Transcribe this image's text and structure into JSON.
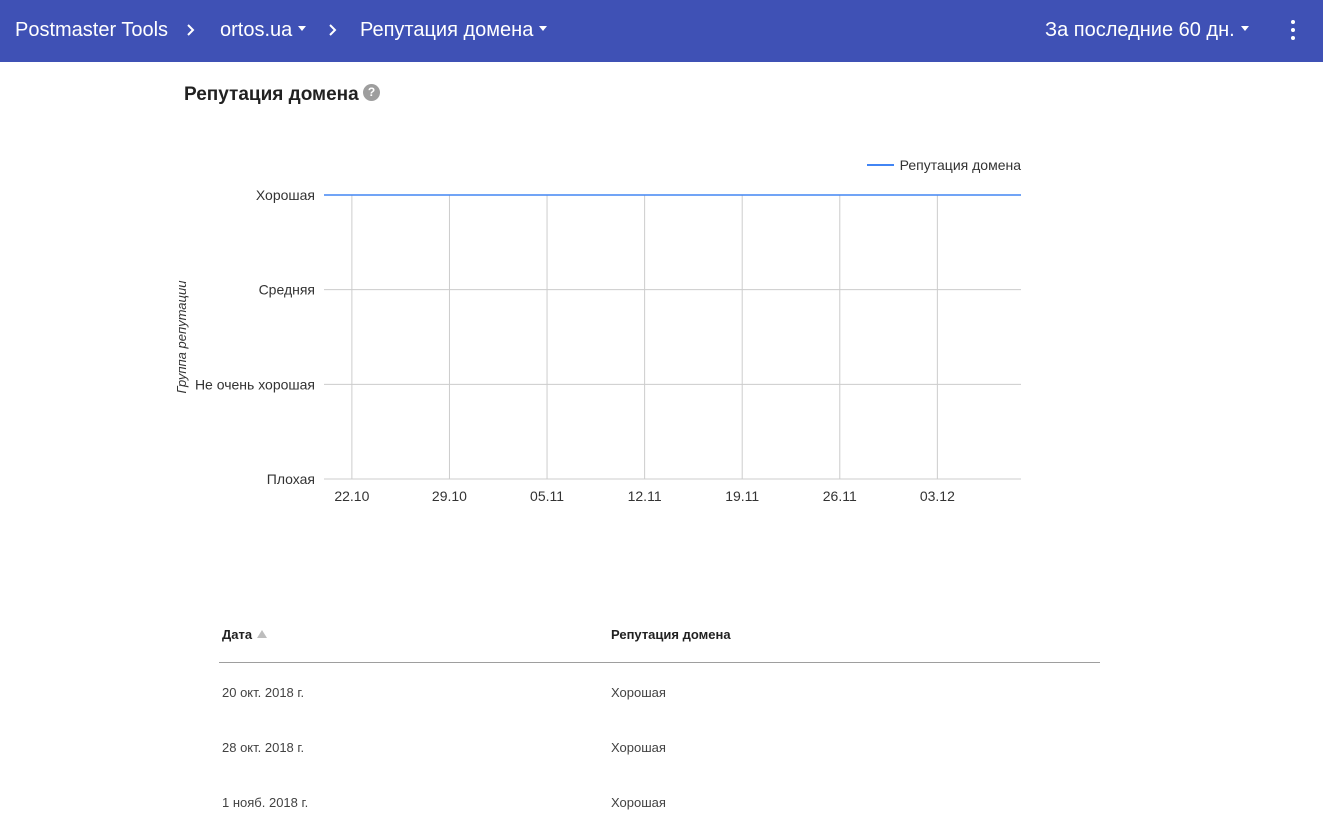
{
  "topbar": {
    "app_title": "Postmaster Tools",
    "domain": "ortos.ua",
    "section": "Репутация домена",
    "period": "За последние 60 дн."
  },
  "page": {
    "title": "Репутация домена",
    "help_glyph": "?"
  },
  "chart_data": {
    "type": "line",
    "title": "",
    "xlabel": "",
    "ylabel": "Группа репутации",
    "categories_y": [
      "Плохая",
      "Не очень хорошая",
      "Средняя",
      "Хорошая"
    ],
    "x_ticks": [
      "22.10",
      "29.10",
      "05.11",
      "12.11",
      "19.11",
      "26.11",
      "03.12"
    ],
    "x_range": [
      "20.10",
      "09.12"
    ],
    "series": [
      {
        "name": "Репутация домена",
        "color": "#4285f4",
        "points": [
          {
            "x": "20.10",
            "y": "Хорошая"
          },
          {
            "x": "09.12",
            "y": "Хорошая"
          }
        ]
      }
    ],
    "legend_position": "top-right",
    "grid": true
  },
  "table": {
    "headers": {
      "date": "Дата",
      "reputation": "Репутация домена"
    },
    "rows": [
      {
        "date": "20 окт. 2018 г.",
        "reputation": "Хорошая"
      },
      {
        "date": "28 окт. 2018 г.",
        "reputation": "Хорошая"
      },
      {
        "date": "1 нояб. 2018 г.",
        "reputation": "Хорошая"
      }
    ]
  },
  "colors": {
    "topbar": "#3f51b5",
    "series": "#4285f4",
    "grid": "#cccccc"
  }
}
